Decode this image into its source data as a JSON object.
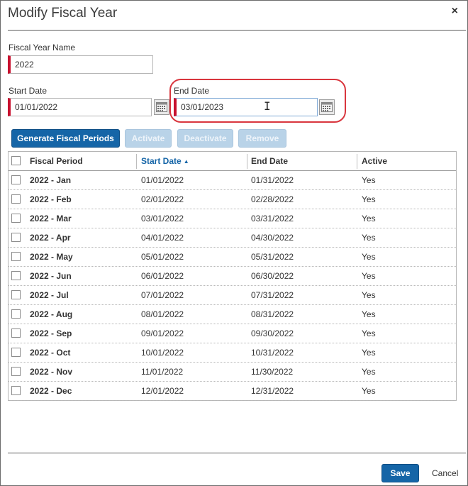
{
  "dialog": {
    "title": "Modify Fiscal Year",
    "close_label": "×"
  },
  "form": {
    "fiscal_year_name_label": "Fiscal Year Name",
    "fiscal_year_name_value": "2022",
    "start_date_label": "Start Date",
    "start_date_value": "01/01/2022",
    "end_date_label": "End Date",
    "end_date_value": "03/01/2023",
    "cursor_glyph": "I"
  },
  "toolbar": {
    "generate_label": "Generate Fiscal Periods",
    "activate_label": "Activate",
    "deactivate_label": "Deactivate",
    "remove_label": "Remove"
  },
  "grid": {
    "columns": {
      "fiscal_period": "Fiscal Period",
      "start_date": "Start Date",
      "end_date": "End Date",
      "active": "Active"
    },
    "sorted_column": "start_date",
    "sort_arrow": "▲",
    "rows": [
      {
        "period": "2022 - Jan",
        "start": "01/01/2022",
        "end": "01/31/2022",
        "active": "Yes"
      },
      {
        "period": "2022 - Feb",
        "start": "02/01/2022",
        "end": "02/28/2022",
        "active": "Yes"
      },
      {
        "period": "2022 - Mar",
        "start": "03/01/2022",
        "end": "03/31/2022",
        "active": "Yes"
      },
      {
        "period": "2022 - Apr",
        "start": "04/01/2022",
        "end": "04/30/2022",
        "active": "Yes"
      },
      {
        "period": "2022 - May",
        "start": "05/01/2022",
        "end": "05/31/2022",
        "active": "Yes"
      },
      {
        "period": "2022 - Jun",
        "start": "06/01/2022",
        "end": "06/30/2022",
        "active": "Yes"
      },
      {
        "period": "2022 - Jul",
        "start": "07/01/2022",
        "end": "07/31/2022",
        "active": "Yes"
      },
      {
        "period": "2022 - Aug",
        "start": "08/01/2022",
        "end": "08/31/2022",
        "active": "Yes"
      },
      {
        "period": "2022 - Sep",
        "start": "09/01/2022",
        "end": "09/30/2022",
        "active": "Yes"
      },
      {
        "period": "2022 - Oct",
        "start": "10/01/2022",
        "end": "10/31/2022",
        "active": "Yes"
      },
      {
        "period": "2022 - Nov",
        "start": "11/01/2022",
        "end": "11/30/2022",
        "active": "Yes"
      },
      {
        "period": "2022 - Dec",
        "start": "12/01/2022",
        "end": "12/31/2022",
        "active": "Yes"
      }
    ]
  },
  "footer": {
    "save_label": "Save",
    "cancel_label": "Cancel"
  },
  "colors": {
    "primary_button": "#1565a7",
    "disabled_button": "#b9d3e8",
    "required_marker": "#c8102e",
    "annotation_circle": "#d9363e"
  },
  "icons": {
    "calendar": "calendar-icon",
    "close": "close-icon",
    "sort": "sort-ascending-icon"
  }
}
